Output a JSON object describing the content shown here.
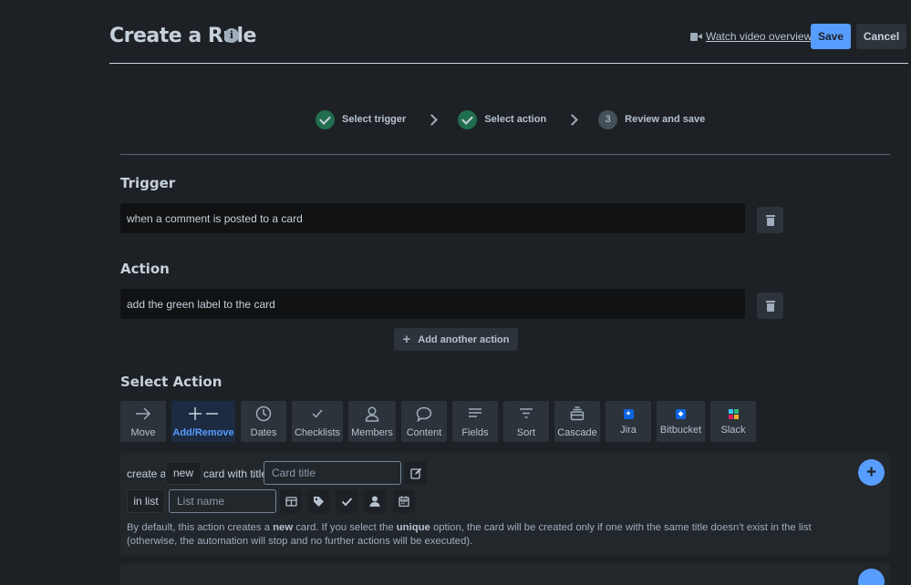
{
  "header": {
    "title": "Create a Rule",
    "info_icon": "i",
    "video_link": "Watch video overview",
    "save_label": "Save",
    "cancel_label": "Cancel"
  },
  "steps": [
    {
      "label": "Select trigger",
      "status": "done"
    },
    {
      "label": "Select action",
      "status": "done"
    },
    {
      "label": "Review and save",
      "number": "3",
      "status": "current"
    }
  ],
  "trigger": {
    "title": "Trigger",
    "value": "when a comment is posted to a card"
  },
  "action": {
    "title": "Action",
    "value": "add the green label to the card",
    "add_another_label": "Add another action"
  },
  "select_action": {
    "title": "Select Action",
    "tabs": [
      {
        "label": "Move",
        "icon": "arrow-right-icon"
      },
      {
        "label": "Add/Remove",
        "icon": "plus-minus-icon",
        "active": true
      },
      {
        "label": "Dates",
        "icon": "clock-icon"
      },
      {
        "label": "Checklists",
        "icon": "check-icon"
      },
      {
        "label": "Members",
        "icon": "person-icon"
      },
      {
        "label": "Content",
        "icon": "speech-bubble-icon"
      },
      {
        "label": "Fields",
        "icon": "lines-icon"
      },
      {
        "label": "Sort",
        "icon": "filter-icon"
      },
      {
        "label": "Cascade",
        "icon": "cascade-icon"
      },
      {
        "label": "Jira",
        "icon": "jira-icon"
      },
      {
        "label": "Bitbucket",
        "icon": "bitbucket-icon"
      },
      {
        "label": "Slack",
        "icon": "slack-icon"
      }
    ]
  },
  "create_card": {
    "text_create_a": "create a",
    "mode_value": "new",
    "text_card_with_title": "card with title",
    "title_placeholder": "Card title",
    "in_list_label": "in list",
    "list_placeholder": "List name",
    "help_1": "By default, this action creates a ",
    "help_bold_1": "new",
    "help_2": " card. If you select the ",
    "help_bold_2": "unique",
    "help_3": " option, the card will be created only if one with the same title doesn't exist in the list (otherwise, the automation will stop and no further actions will be executed)."
  },
  "colors": {
    "background": "#1d2125",
    "accent": "#579dff",
    "success": "#216e4e",
    "field": "#101214",
    "button": "#2c333a"
  }
}
